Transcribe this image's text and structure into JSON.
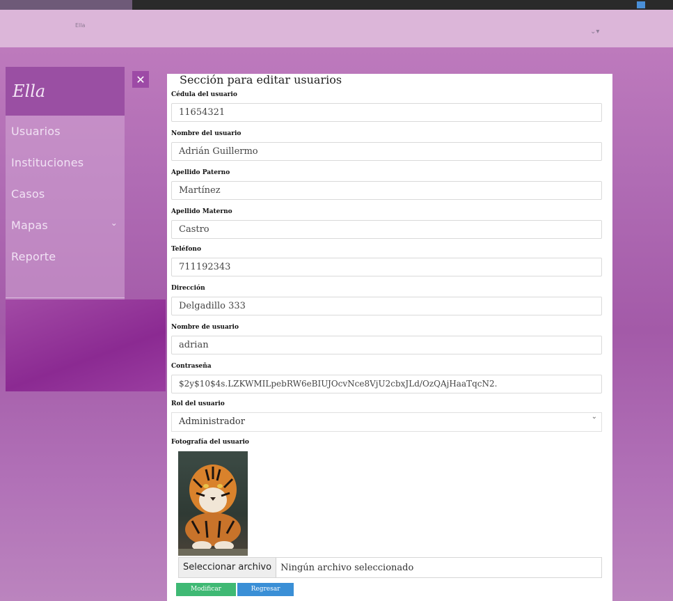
{
  "header": {
    "small_title": "Ella",
    "user_menu_glyph": "⌄▾"
  },
  "sidebar": {
    "brand": "Ella",
    "items": [
      {
        "label": "Usuarios"
      },
      {
        "label": "Instituciones"
      },
      {
        "label": "Casos"
      },
      {
        "label": "Mapas",
        "chevron": "⌄"
      },
      {
        "label": "Reporte"
      }
    ]
  },
  "close_button": {
    "glyph": "✕"
  },
  "form": {
    "title": "Sección para editar usuarios",
    "fields": [
      {
        "label": "Cédula del usuario",
        "value": "11654321"
      },
      {
        "label": "Nombre del usuario",
        "value": "Adrián Guillermo"
      },
      {
        "label": "Apellido Paterno",
        "value": "Martínez"
      },
      {
        "label": "Apellido Materno",
        "value": "Castro"
      },
      {
        "label": "Teléfono",
        "value": "711192343"
      },
      {
        "label": "Dirección",
        "value": "Delgadillo 333"
      },
      {
        "label": "Nombre de usuario",
        "value": "adrian"
      },
      {
        "label": "Contraseña",
        "value": "$2y$10$4s.LZKWMILpebRW6eBIUJOcvNce8VjU2cbxJLd/OzQAjHaaTqcN2."
      }
    ],
    "role": {
      "label": "Rol del usuario",
      "selected": "Administrador"
    },
    "photo": {
      "label": "Fotografía del usuario"
    },
    "file": {
      "button": "Seleccionar archivo",
      "status": "Ningún archivo seleccionado"
    },
    "buttons": {
      "modify": "Modificar",
      "back": "Regresar"
    }
  },
  "colors": {
    "accent_purple": "#9a4fa3",
    "green": "#3fb974",
    "blue": "#3a8fd6"
  }
}
